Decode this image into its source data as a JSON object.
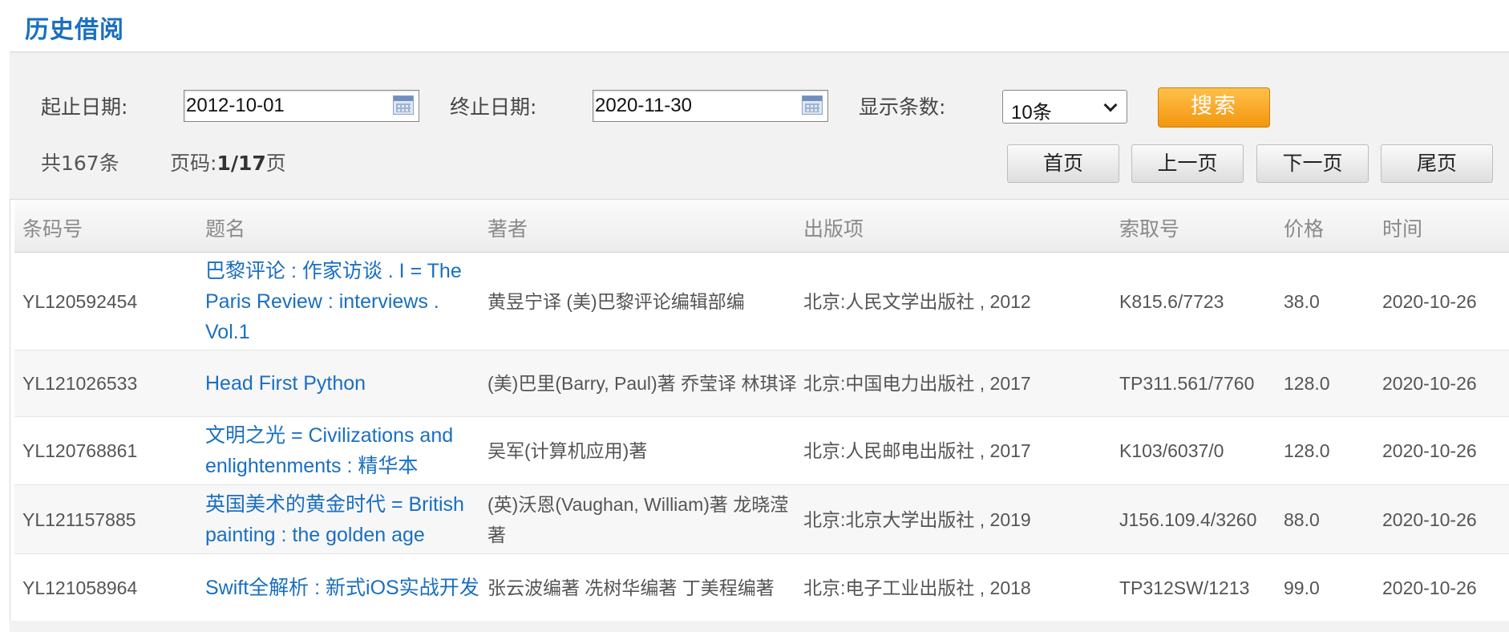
{
  "page_title": "历史借阅",
  "filters": {
    "start_label": "起止日期:",
    "start_value": "2012-10-01",
    "end_label": "终止日期:",
    "end_value": "2020-11-30",
    "count_label": "显示条数:",
    "count_value": "10条",
    "search_label": "搜索"
  },
  "summary": {
    "total_text": "共167条",
    "page_prefix": "页码:",
    "page_value": "1/17",
    "page_suffix": "页"
  },
  "pager": {
    "first": "首页",
    "prev": "上一页",
    "next": "下一页",
    "last": "尾页"
  },
  "table": {
    "headers": [
      "条码号",
      "题名",
      "著者",
      "出版项",
      "索取号",
      "价格",
      "时间"
    ],
    "rows": [
      {
        "barcode": "YL120592454",
        "title": "巴黎评论 : 作家访谈 . I = The Paris Review : interviews . Vol.1",
        "author": "黄昱宁译 (美)巴黎评论编辑部编",
        "publisher": "北京:人民文学出版社 , 2012",
        "callno": "K815.6/7723",
        "price": "38.0",
        "date": "2020-10-26"
      },
      {
        "barcode": "YL121026533",
        "title": "Head First Python",
        "author": "(美)巴里(Barry, Paul)著 乔莹译 林琪译",
        "publisher": "北京:中国电力出版社 , 2017",
        "callno": "TP311.561/7760",
        "price": "128.0",
        "date": "2020-10-26"
      },
      {
        "barcode": "YL120768861",
        "title": "文明之光 = Civilizations and enlightenments : 精华本",
        "author": "吴军(计算机应用)著",
        "publisher": "北京:人民邮电出版社 , 2017",
        "callno": "K103/6037/0",
        "price": "128.0",
        "date": "2020-10-26"
      },
      {
        "barcode": "YL121157885",
        "title": "英国美术的黄金时代 = British painting : the golden age",
        "author": "(英)沃恩(Vaughan, William)著 龙晓滢著",
        "publisher": "北京:北京大学出版社 , 2019",
        "callno": "J156.109.4/3260",
        "price": "88.0",
        "date": "2020-10-26"
      },
      {
        "barcode": "YL121058964",
        "title": "Swift全解析 : 新式iOS实战开发",
        "author": "张云波编著 冼树华编著 丁美程编著",
        "publisher": "北京:电子工业出版社 , 2018",
        "callno": "TP312SW/1213",
        "price": "99.0",
        "date": "2020-10-26"
      }
    ]
  },
  "colors": {
    "link_blue": "#1a6fc0",
    "search_orange": "#f3960e"
  }
}
